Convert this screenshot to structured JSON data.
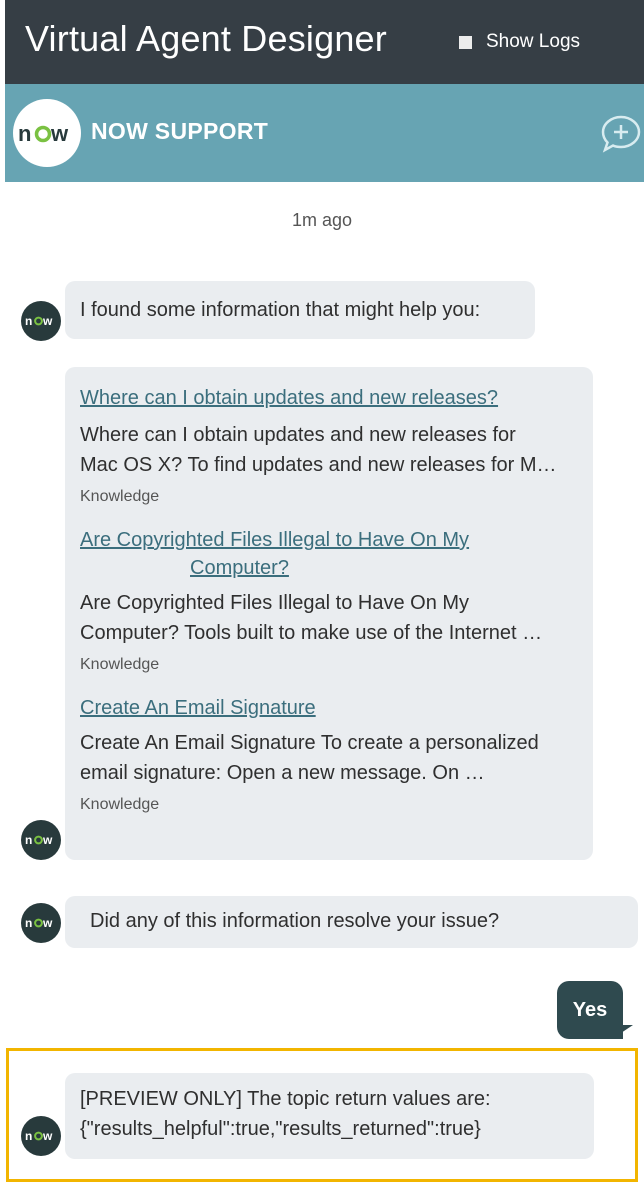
{
  "header": {
    "app_title": "Virtual Agent Designer",
    "show_logs_label": "Show Logs"
  },
  "support_bar": {
    "logo_text": "now",
    "title": "NOW SUPPORT",
    "new_chat_icon": "chat-plus-icon"
  },
  "conversation": {
    "timestamp": "1m ago",
    "agent_intro": "I found some information that might help you:",
    "results": [
      {
        "title_line1": "Where can I obtain updates and new releases?",
        "title_line2": "",
        "snippet_line1": "Where can I obtain updates and new releases for",
        "snippet_line2": "Mac OS X? To find updates and new releases for M…",
        "source": "Knowledge"
      },
      {
        "title_line1": "Are Copyrighted Files Illegal to Have On My",
        "title_line2": "Computer?",
        "snippet_line1": "Are Copyrighted Files Illegal to Have On My",
        "snippet_line2": "Computer? Tools built to make use of the Internet …",
        "source": "Knowledge"
      },
      {
        "title_line1": "Create An Email Signature",
        "title_line2": "",
        "snippet_line1": "Create An Email Signature To create a personalized",
        "snippet_line2": "email signature: Open a new message. On …",
        "source": "Knowledge"
      }
    ],
    "agent_question": "Did any of this information resolve your issue?",
    "user_reply": "Yes",
    "preview_line1": "[PREVIEW ONLY] The topic return values are:",
    "preview_line2": "{\"results_helpful\":true,\"results_returned\":true}"
  },
  "colors": {
    "topbar": "#363e45",
    "support_bar": "#67a4b3",
    "bubble": "#eaedf0",
    "user_bubble": "#2f4a4f",
    "link": "#3b6e7d",
    "highlight_border": "#f2b500"
  }
}
